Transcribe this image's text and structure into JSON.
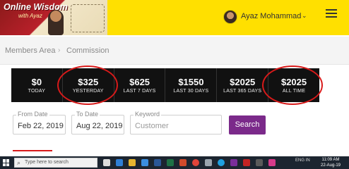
{
  "header": {
    "logo": {
      "line1": "Online Wisdom",
      "line2": "with Ayaz"
    },
    "user_name": "Ayaz Mohammad",
    "user_chevron": "⌄"
  },
  "breadcrumb": {
    "items": [
      "Members Area",
      "Commission"
    ],
    "separator": "›"
  },
  "stats": [
    {
      "value": "$0",
      "label": "TODAY",
      "circled": false
    },
    {
      "value": "$325",
      "label": "YESTERDAY",
      "circled": true
    },
    {
      "value": "$625",
      "label": "LAST 7 DAYS",
      "circled": false
    },
    {
      "value": "$1550",
      "label": "LAST 30 DAYS",
      "circled": false
    },
    {
      "value": "$2025",
      "label": "LAST 365 DAYS",
      "circled": false
    },
    {
      "value": "$2025",
      "label": "ALL TIME",
      "circled": true
    }
  ],
  "filters": {
    "from_date": {
      "label": "From Date",
      "value": "Feb 22, 2019"
    },
    "to_date": {
      "label": "To Date",
      "value": "Aug 22, 2019"
    },
    "keyword": {
      "label": "Keyword",
      "placeholder": "Customer",
      "value": ""
    },
    "search_label": "Search"
  },
  "taskbar": {
    "search_placeholder": "Type here to search",
    "search_icon": "search-icon",
    "tray_text": "ENG IN",
    "time": "11:09 AM",
    "date": "22-Aug-19"
  },
  "colors": {
    "header_bg": "#ffe000",
    "stats_bg": "#111111",
    "circle": "#d81a1a",
    "search_button": "#7b2a8a",
    "taskbar_bg": "#1c2530"
  }
}
